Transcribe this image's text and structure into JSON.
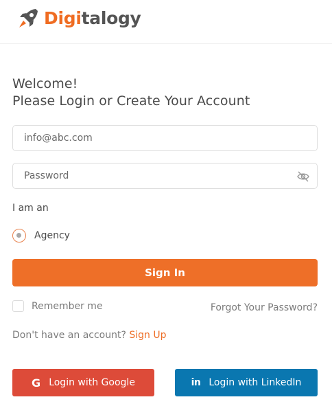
{
  "header": {
    "logo_text_accent": "Digi",
    "logo_text_rest": "talogy",
    "brand_color": "#ef6c22"
  },
  "welcome": {
    "line1": "Welcome!",
    "line2": "Please Login or Create Your Account"
  },
  "form": {
    "email_placeholder": "info@abc.com",
    "password_placeholder": "Password",
    "password_toggle_icon": "eye-slash-icon",
    "role_prompt": "I am an",
    "role_option": "Agency",
    "signin_label": "Sign In",
    "remember_label": "Remember me",
    "forgot_label": "Forgot Your Password?",
    "signup_prompt": "Don't have an account?",
    "signup_link": "Sign Up"
  },
  "social": {
    "google_icon": "G",
    "google_label": "Login with Google",
    "google_color": "#dd4b39",
    "linkedin_icon": "in",
    "linkedin_label": "Login with LinkedIn",
    "linkedin_color": "#0a77b0"
  }
}
